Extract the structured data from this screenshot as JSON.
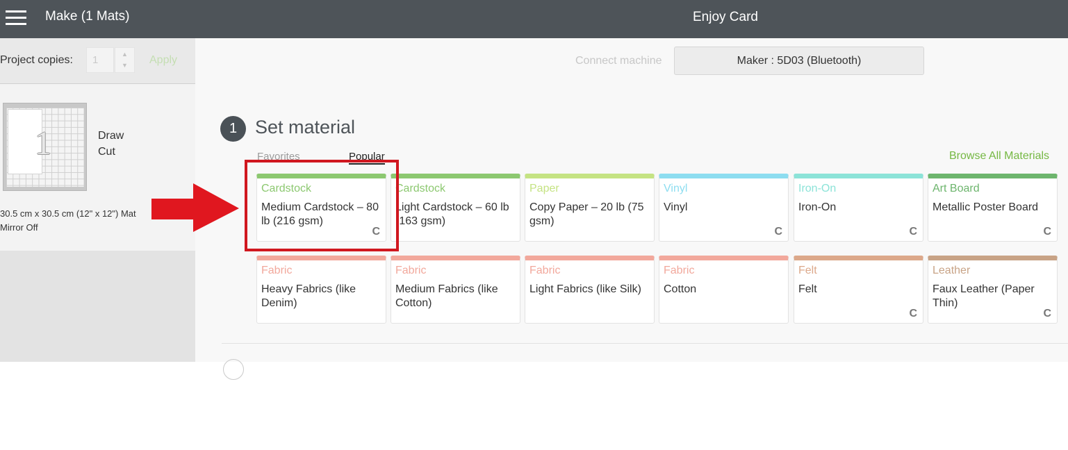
{
  "header": {
    "make_title": "Make (1 Mats)",
    "project_title": "Enjoy Card"
  },
  "sidebar": {
    "copies_label": "Project copies:",
    "copies_value": "1",
    "apply_label": "Apply",
    "mat": {
      "number": "1",
      "operations": [
        "Draw",
        "Cut"
      ],
      "size": "30.5 cm x 30.5 cm (12\" x 12\") Mat",
      "mirror": "Mirror Off"
    }
  },
  "main": {
    "connect_label": "Connect machine",
    "machine_label": "Maker : 5D03 (Bluetooth)",
    "step": {
      "number": "1",
      "title": "Set material"
    },
    "tabs": {
      "favorites": "Favorites",
      "popular": "Popular"
    },
    "browse_all": "Browse All Materials",
    "fav_icon": "C",
    "materials_row1": [
      {
        "category": "Cardstock",
        "name": "Medium Cardstock – 80 lb (216 gsm)",
        "color": "#8cc870",
        "fav": true
      },
      {
        "category": "Cardstock",
        "name": "Light Cardstock – 60 lb (163 gsm)",
        "color": "#8cc870",
        "fav": false
      },
      {
        "category": "Paper",
        "name": "Copy Paper – 20 lb (75 gsm)",
        "color": "#c5e383",
        "fav": false
      },
      {
        "category": "Vinyl",
        "name": "Vinyl",
        "color": "#8dddf0",
        "fav": true
      },
      {
        "category": "Iron-On",
        "name": "Iron-On",
        "color": "#8ce3d8",
        "fav": true
      },
      {
        "category": "Art Board",
        "name": "Metallic Poster Board",
        "color": "#6db56d",
        "fav": true
      }
    ],
    "materials_row2": [
      {
        "category": "Fabric",
        "name": "Heavy Fabrics (like Denim)",
        "color": "#f2a89c",
        "fav": false
      },
      {
        "category": "Fabric",
        "name": "Medium Fabrics (like Cotton)",
        "color": "#f2a89c",
        "fav": false
      },
      {
        "category": "Fabric",
        "name": "Light Fabrics (like Silk)",
        "color": "#f2a89c",
        "fav": false
      },
      {
        "category": "Fabric",
        "name": "Cotton",
        "color": "#f2a89c",
        "fav": false
      },
      {
        "category": "Felt",
        "name": "Felt",
        "color": "#dca88a",
        "fav": true
      },
      {
        "category": "Leather",
        "name": "Faux Leather (Paper Thin)",
        "color": "#c8a386",
        "fav": true
      }
    ]
  },
  "annotation": {
    "highlight_color": "#d0171f",
    "arrow_color": "#e0171f"
  }
}
